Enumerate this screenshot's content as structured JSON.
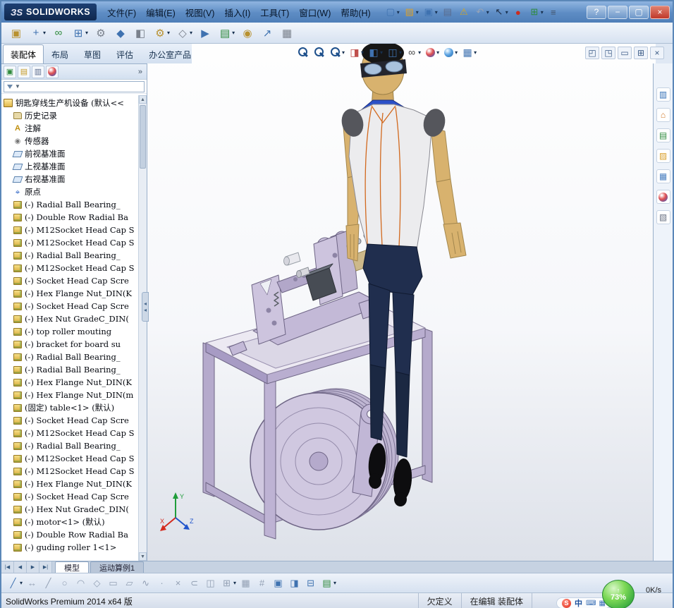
{
  "titlebar": {
    "brand_mark": "ЗS",
    "brand": "SOLIDWORKS",
    "menus": [
      "文件(F)",
      "编辑(E)",
      "视图(V)",
      "插入(I)",
      "工具(T)",
      "窗口(W)",
      "帮助(H)"
    ],
    "quick_icons": [
      {
        "name": "new-document-icon",
        "glyph": "▢",
        "color": "#3f72b0",
        "caret": "▾"
      },
      {
        "name": "open-document-icon",
        "glyph": "▨",
        "color": "#d9a02e",
        "caret": "▾"
      },
      {
        "name": "save-icon",
        "glyph": "▣",
        "color": "#3f72b0",
        "caret": "▾"
      },
      {
        "name": "print-icon",
        "glyph": "▤",
        "color": "#5a6b8c",
        "caret": ""
      },
      {
        "name": "rebuild-icon",
        "glyph": "⚠",
        "color": "#d7a71f",
        "caret": ""
      },
      {
        "name": "undo-icon",
        "glyph": "↶",
        "color": "#9aa4b5",
        "caret": "▾"
      },
      {
        "name": "select-icon",
        "glyph": "↖",
        "color": "#1c2c44",
        "caret": "▾"
      },
      {
        "name": "record-macro-icon",
        "glyph": "●",
        "color": "#cc2d1f",
        "caret": ""
      },
      {
        "name": "options-icon",
        "glyph": "⊞",
        "color": "#2f8a3d",
        "caret": "▾"
      },
      {
        "name": "command-list-icon",
        "glyph": "≡",
        "color": "#44566e",
        "caret": ""
      }
    ],
    "window_buttons": [
      {
        "name": "help-button",
        "glyph": "?",
        "cls": ""
      },
      {
        "name": "minimize-button",
        "glyph": "−",
        "cls": ""
      },
      {
        "name": "maximize-button",
        "glyph": "▢",
        "cls": ""
      },
      {
        "name": "close-button",
        "glyph": "×",
        "cls": "close"
      }
    ]
  },
  "toolbar2": {
    "icons": [
      {
        "name": "edit-component-icon",
        "glyph": "▣",
        "color": "#b8912f",
        "caret": ""
      },
      {
        "name": "insert-components-icon",
        "glyph": "+",
        "color": "#3f72b0",
        "caret": "▾"
      },
      {
        "name": "mate-icon",
        "glyph": "∞",
        "color": "#2f8a3d",
        "caret": ""
      },
      {
        "name": "component-pattern-icon",
        "glyph": "⊞",
        "color": "#3f72b0",
        "caret": "▾"
      },
      {
        "name": "smart-fasteners-icon",
        "glyph": "⚙",
        "color": "#7a818c",
        "caret": ""
      },
      {
        "name": "move-component-icon",
        "glyph": "◆",
        "color": "#3f72b0",
        "caret": ""
      },
      {
        "name": "show-hidden-components-icon",
        "glyph": "◧",
        "color": "#7a818c",
        "caret": ""
      },
      {
        "name": "assembly-features-icon",
        "glyph": "⚙",
        "color": "#b8912f",
        "caret": "▾"
      },
      {
        "name": "reference-geometry-icon",
        "glyph": "◇",
        "color": "#7a818c",
        "caret": "▾"
      },
      {
        "name": "new-motion-study-icon",
        "glyph": "▶",
        "color": "#3f72b0",
        "caret": ""
      },
      {
        "name": "bill-of-materials-icon",
        "glyph": "▤",
        "color": "#2f8a3d",
        "caret": "▾"
      },
      {
        "name": "exploded-view-icon",
        "glyph": "◉",
        "color": "#b8912f",
        "caret": ""
      },
      {
        "name": "instant3d-icon",
        "glyph": "↗",
        "color": "#3f72b0",
        "caret": ""
      },
      {
        "name": "snapshot-icon",
        "glyph": "▦",
        "color": "#7a818c",
        "caret": ""
      }
    ]
  },
  "command_tabs": [
    {
      "label": "装配体",
      "cls": "active"
    },
    {
      "label": "布局",
      "cls": ""
    },
    {
      "label": "草图",
      "cls": ""
    },
    {
      "label": "评估",
      "cls": ""
    },
    {
      "label": "办公室产品",
      "cls": ""
    }
  ],
  "hud": {
    "items": [
      {
        "name": "zoom-fit-icon",
        "kind": "i-mag",
        "glyph": "",
        "caret": ""
      },
      {
        "name": "zoom-area-icon",
        "kind": "i-mag",
        "glyph": "",
        "caret": ""
      },
      {
        "name": "previous-view-icon",
        "kind": "i-mag",
        "glyph": "",
        "caret": "▾"
      },
      {
        "name": "section-view-icon",
        "kind": "",
        "glyph": "◨",
        "color": "#c0504d",
        "caret": "▾"
      },
      {
        "name": "view-orientation-icon",
        "kind": "",
        "glyph": "◧",
        "color": "#3f72b0",
        "caret": "▾"
      },
      {
        "name": "display-style-icon",
        "kind": "",
        "glyph": "◫",
        "color": "#3f72b0",
        "caret": "▾"
      },
      {
        "name": "hide-show-items-icon",
        "kind": "",
        "glyph": "∞",
        "color": "#444444",
        "caret": "▾"
      },
      {
        "name": "edit-appearance-icon",
        "kind": "i-ball-a",
        "glyph": "",
        "caret": "▾"
      },
      {
        "name": "apply-scene-icon",
        "kind": "i-ball-s",
        "glyph": "",
        "caret": "▾"
      },
      {
        "name": "view-settings-icon",
        "kind": "",
        "glyph": "▦",
        "color": "#3f72b0",
        "caret": "▾"
      }
    ],
    "pane_controls": [
      {
        "name": "pane-single-icon",
        "glyph": "◰"
      },
      {
        "name": "pane-two-icon",
        "glyph": "◳"
      },
      {
        "name": "pane-horizontal-icon",
        "glyph": "▭"
      },
      {
        "name": "pane-four-icon",
        "glyph": "⊞"
      },
      {
        "name": "pane-close-icon",
        "glyph": "×"
      }
    ]
  },
  "panel": {
    "tabs": [
      {
        "name": "featuremanager-tab-icon",
        "glyph": "▣",
        "color": "#2f8a3d",
        "kind": ""
      },
      {
        "name": "propertymanager-tab-icon",
        "glyph": "▤",
        "color": "#c59a27",
        "kind": ""
      },
      {
        "name": "configurationmanager-tab-icon",
        "glyph": "▥",
        "color": "#5a6b8c",
        "kind": ""
      },
      {
        "name": "displaymanager-tab-icon",
        "glyph": "",
        "color": "",
        "kind": "i-ball-a"
      }
    ],
    "more": "»",
    "filter_caret": "▼"
  },
  "tree": {
    "items": [
      {
        "cls": "ic-root",
        "rowcls": "root",
        "label": "钥匙穿线生产机设备 (默认<<"
      },
      {
        "cls": "ic-hist",
        "label": "历史记录"
      },
      {
        "cls": "ic-ann",
        "label": "注解"
      },
      {
        "cls": "ic-sensor",
        "label": "传感器"
      },
      {
        "cls": "ic-plane",
        "label": "前视基准面"
      },
      {
        "cls": "ic-plane",
        "label": "上视基准面"
      },
      {
        "cls": "ic-plane",
        "label": "右视基准面"
      },
      {
        "cls": "ic-origin",
        "label": "原点"
      },
      {
        "cls": "ic-part",
        "label": "(-) Radial Ball Bearing_"
      },
      {
        "cls": "ic-part",
        "label": "(-) Double Row Radial Ba"
      },
      {
        "cls": "ic-part",
        "label": "(-) M12Socket Head Cap S"
      },
      {
        "cls": "ic-part",
        "label": "(-) M12Socket Head Cap S"
      },
      {
        "cls": "ic-part",
        "label": "(-) Radial Ball Bearing_"
      },
      {
        "cls": "ic-part",
        "label": "(-) M12Socket Head Cap S"
      },
      {
        "cls": "ic-part",
        "label": "(-) Socket Head Cap Scre"
      },
      {
        "cls": "ic-part",
        "label": "(-) Hex Flange Nut_DIN(K"
      },
      {
        "cls": "ic-part",
        "label": "(-) Socket Head Cap Scre"
      },
      {
        "cls": "ic-part",
        "label": "(-) Hex Nut GradeC_DIN("
      },
      {
        "cls": "ic-part",
        "label": "(-) top  roller mouting"
      },
      {
        "cls": "ic-part",
        "label": "(-) bracket for board su"
      },
      {
        "cls": "ic-part",
        "label": "(-) Radial Ball Bearing_"
      },
      {
        "cls": "ic-part",
        "label": "(-) Radial Ball Bearing_"
      },
      {
        "cls": "ic-part",
        "label": "(-) Hex Flange Nut_DIN(K"
      },
      {
        "cls": "ic-part",
        "label": "(-) Hex Flange Nut_DIN(m"
      },
      {
        "cls": "ic-part",
        "label": "(固定) table<1> (默认)"
      },
      {
        "cls": "ic-part",
        "label": "(-) Socket Head Cap Scre"
      },
      {
        "cls": "ic-part",
        "label": "(-) M12Socket Head Cap S"
      },
      {
        "cls": "ic-part",
        "label": "(-) Radial Ball Bearing_"
      },
      {
        "cls": "ic-part",
        "label": "(-) M12Socket Head Cap S"
      },
      {
        "cls": "ic-part",
        "label": "(-) M12Socket Head Cap S"
      },
      {
        "cls": "ic-part",
        "label": "(-) Hex Flange Nut_DIN(K"
      },
      {
        "cls": "ic-part",
        "label": "(-) Socket Head Cap Scre"
      },
      {
        "cls": "ic-part",
        "label": "(-) Hex Nut GradeC_DIN("
      },
      {
        "cls": "ic-part",
        "label": "(-) motor<1> (默认)"
      },
      {
        "cls": "ic-part",
        "label": "(-) Double Row Radial Ba"
      },
      {
        "cls": "ic-part",
        "label": "(-) guding roller 1<1>"
      }
    ]
  },
  "taskpane": {
    "items": [
      {
        "name": "solidworks-forum-icon",
        "glyph": "▥",
        "color": "#2f6db5",
        "kind": ""
      },
      {
        "name": "solidworks-resources-icon",
        "glyph": "⌂",
        "color": "#d07a2a",
        "kind": ""
      },
      {
        "name": "design-library-icon",
        "glyph": "▤",
        "color": "#2f8a3d",
        "kind": ""
      },
      {
        "name": "file-explorer-icon",
        "glyph": "▨",
        "color": "#d9a02e",
        "kind": ""
      },
      {
        "name": "view-palette-icon",
        "glyph": "▦",
        "color": "#4a7fc0",
        "kind": ""
      },
      {
        "name": "appearances-scenes-icon",
        "glyph": "",
        "color": "",
        "kind": "i-ball-a"
      },
      {
        "name": "custom-properties-icon",
        "glyph": "▧",
        "color": "#6a7283",
        "kind": ""
      }
    ]
  },
  "bottom_tabs": {
    "nav": [
      "|◀",
      "◀",
      "▶",
      "▶|"
    ],
    "tabs": [
      {
        "label": "模型",
        "cls": "active"
      },
      {
        "label": "运动算例1",
        "cls": ""
      }
    ]
  },
  "sketchbar": {
    "items": [
      {
        "name": "sketch-icon",
        "glyph": "╱",
        "color": "#3f72b0",
        "caret": "▾"
      },
      {
        "name": "smart-dimension-icon",
        "glyph": "↔",
        "color": "#93a0b4",
        "caret": ""
      },
      {
        "name": "line-icon",
        "glyph": "╱",
        "color": "#93a0b4",
        "caret": ""
      },
      {
        "name": "circle-icon",
        "glyph": "○",
        "color": "#93a0b4",
        "caret": ""
      },
      {
        "name": "arc-icon",
        "glyph": "◠",
        "color": "#93a0b4",
        "caret": ""
      },
      {
        "name": "polygon-icon",
        "glyph": "◇",
        "color": "#93a0b4",
        "caret": ""
      },
      {
        "name": "rectangle-icon",
        "glyph": "▭",
        "color": "#93a0b4",
        "caret": ""
      },
      {
        "name": "slot-icon",
        "glyph": "▱",
        "color": "#93a0b4",
        "caret": ""
      },
      {
        "name": "spline-icon",
        "glyph": "∿",
        "color": "#93a0b4",
        "caret": ""
      },
      {
        "name": "point-icon",
        "glyph": "·",
        "color": "#93a0b4",
        "caret": ""
      },
      {
        "name": "trim-entities-icon",
        "glyph": "×",
        "color": "#93a0b4",
        "caret": ""
      },
      {
        "name": "convert-entities-icon",
        "glyph": "⊂",
        "color": "#93a0b4",
        "caret": ""
      },
      {
        "name": "mirror-entities-icon",
        "glyph": "◫",
        "color": "#93a0b4",
        "caret": ""
      },
      {
        "name": "linear-sketch-pattern-icon",
        "glyph": "⊞",
        "color": "#93a0b4",
        "caret": "▾"
      },
      {
        "name": "grid-icon",
        "glyph": "▦",
        "color": "#93a0b4",
        "caret": ""
      },
      {
        "name": "snap-icon",
        "glyph": "#",
        "color": "#93a0b4",
        "caret": ""
      },
      {
        "name": "normal-to-icon",
        "glyph": "▣",
        "color": "#3f72b0",
        "caret": ""
      },
      {
        "name": "display-style-mini-icon",
        "glyph": "◨",
        "color": "#3f72b0",
        "caret": ""
      },
      {
        "name": "hide-planes-icon",
        "glyph": "⊟",
        "color": "#3f72b0",
        "caret": ""
      },
      {
        "name": "tables-icon",
        "glyph": "▤",
        "color": "#2f8a3d",
        "caret": "▾"
      }
    ]
  },
  "statusbar": {
    "left": "SolidWorks Premium 2014 x64 版",
    "cells": [
      "欠定义",
      "在编辑  装配体"
    ]
  },
  "widgets": {
    "percent": "73%",
    "arrow": "↑",
    "speed": "0K/s",
    "ime": {
      "logo": "S",
      "mode": "中",
      "icons": [
        "⌨",
        "▦"
      ]
    }
  },
  "viewport": {
    "triad": {
      "x": "X",
      "y": "Y",
      "z": "Z"
    }
  },
  "colors": {
    "titlebar_blue": "#5d8cc4",
    "machine_lavender": "#c9c0db",
    "mannequin_skin": "#d8b26e",
    "mannequin_pants": "#202e4e",
    "mannequin_collar": "#2b50c8",
    "vest_trim_orange": "#d2691e",
    "status_ball_green": "#2fa43c"
  }
}
